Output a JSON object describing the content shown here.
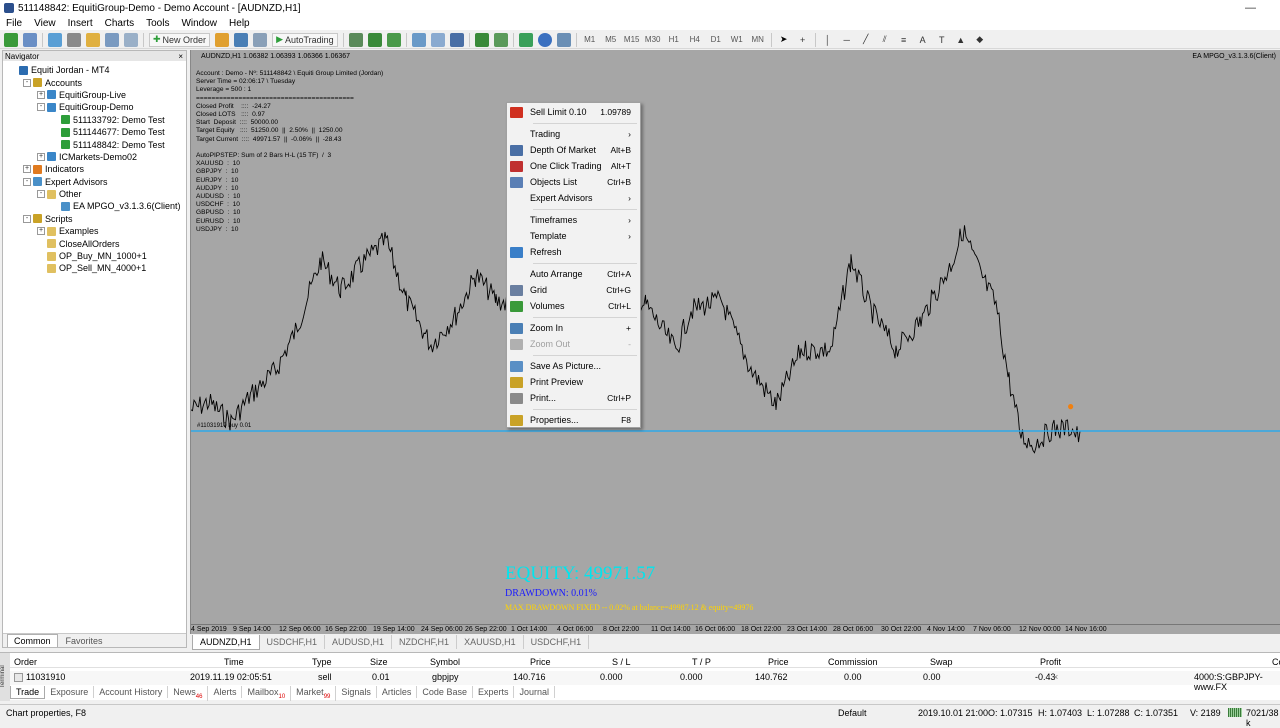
{
  "window": {
    "title": "511148842: EquitiGroup-Demo - Demo Account - [AUDNZD,H1]"
  },
  "menu": [
    "File",
    "View",
    "Insert",
    "Charts",
    "Tools",
    "Window",
    "Help"
  ],
  "toolbar": {
    "new_order": "New Order",
    "autotrading": "AutoTrading",
    "timeframes": [
      "M1",
      "M5",
      "M15",
      "M30",
      "H1",
      "H4",
      "D1",
      "W1",
      "MN"
    ]
  },
  "navigator": {
    "title": "Navigator",
    "tree": [
      {
        "label": "Equiti Jordan - MT4",
        "level": 0,
        "exp": "",
        "icon": "terminal-icon",
        "color": "#2b6cb0"
      },
      {
        "label": "Accounts",
        "level": 1,
        "exp": "-",
        "icon": "accounts-icon",
        "color": "#c9a227"
      },
      {
        "label": "EquitiGroup-Live",
        "level": 2,
        "exp": "+",
        "icon": "server-icon",
        "color": "#3a86c8"
      },
      {
        "label": "EquitiGroup-Demo",
        "level": 2,
        "exp": "-",
        "icon": "server-icon",
        "color": "#3a86c8"
      },
      {
        "label": "511133792: Demo Test",
        "level": 3,
        "exp": "",
        "icon": "user-icon",
        "color": "#2e9e3a"
      },
      {
        "label": "511144677: Demo Test",
        "level": 3,
        "exp": "",
        "icon": "user-icon",
        "color": "#2e9e3a"
      },
      {
        "label": "511148842: Demo Test",
        "level": 3,
        "exp": "",
        "icon": "user-icon",
        "color": "#2e9e3a"
      },
      {
        "label": "ICMarkets-Demo02",
        "level": 2,
        "exp": "+",
        "icon": "server-icon",
        "color": "#3a86c8"
      },
      {
        "label": "Indicators",
        "level": 1,
        "exp": "+",
        "icon": "indicators-icon",
        "color": "#e07a1f"
      },
      {
        "label": "Expert Advisors",
        "level": 1,
        "exp": "-",
        "icon": "experts-icon",
        "color": "#4a90c8"
      },
      {
        "label": "Other",
        "level": 2,
        "exp": "-",
        "icon": "folder-icon",
        "color": "#e0c060"
      },
      {
        "label": "EA MPGO_v3.1.3.6(Client)",
        "level": 3,
        "exp": "",
        "icon": "expert-icon",
        "color": "#4a90c8"
      },
      {
        "label": "Scripts",
        "level": 1,
        "exp": "-",
        "icon": "scripts-icon",
        "color": "#c9a227"
      },
      {
        "label": "Examples",
        "level": 2,
        "exp": "+",
        "icon": "folder-icon",
        "color": "#e0c060"
      },
      {
        "label": "CloseAllOrders",
        "level": 2,
        "exp": "",
        "icon": "script-icon",
        "color": "#e0c060"
      },
      {
        "label": "OP_Buy_MN_1000+1",
        "level": 2,
        "exp": "",
        "icon": "script-icon",
        "color": "#e0c060"
      },
      {
        "label": "OP_Sell_MN_4000+1",
        "level": 2,
        "exp": "",
        "icon": "script-icon",
        "color": "#e0c060"
      }
    ],
    "tabs": [
      "Common",
      "Favorites"
    ]
  },
  "chart": {
    "header": "AUDNZD,H1  1.06382 1.06393 1.06366 1.06367",
    "ea_label": "EA MPGO_v3.1.3.6(Client)",
    "info_text": "Account : Demo - Nº: 511148842 \\ Equiti Group Limited (Jordan)\nServer Time = 02:06:17 \\ Tuesday\nLeverage = 500 : 1\n=========================================\nClosed Profit    ::::  -24.27\nClosed LOTS   ::::  0.97\nStart  Deposit  ::::  50000.00\nTarget Equity   ::::  51250.00  ||  2.50%  ||  1250.00\nTarget Current  ::::  49971.57  ||  -0.06%  ||  -28.43\n\nAutoPIPSTEP: Sum of 2 Bars H-L (15 TF)  /  3\nXAUUSD  :  10\nGBPJPY  :  10\nEURJPY  :  10\nAUDJPY  :  10\nAUDUSD  :  10\nUSDCHF  :  10\nGBPUSD  :  10\nEURUSD  :  10\nUSDJPY  :  10",
    "trade_label": "#11031910 buy 0.01",
    "equity": "EQUITY:  49971.57",
    "drawdown": "DRAWDOWN: 0.01%",
    "max_drawdown": "MAX DRAWDOWN FIXED -- 0.02% at balance=49987.12 & equity=49976",
    "x_ticks": [
      "4 Sep 2019",
      "9 Sep 14:00",
      "12 Sep 06:00",
      "16 Sep 22:00",
      "19 Sep 14:00",
      "24 Sep 06:00",
      "26 Sep 22:00",
      "1 Oct 14:00",
      "4 Oct 06:00",
      "8 Oct 22:00",
      "11 Oct 14:00",
      "16 Oct 06:00",
      "18 Oct 22:00",
      "23 Oct 14:00",
      "28 Oct 06:00",
      "30 Oct 22:00",
      "4 Nov 14:00",
      "7 Nov 06:00",
      "12 Nov 00:00",
      "14 Nov 16:00"
    ],
    "symbol_tabs": [
      "AUDNZD,H1",
      "USDCHF,H1",
      "AUDUSD,H1",
      "NZDCHF,H1",
      "XAUUSD,H1",
      "USDCHF,H1"
    ]
  },
  "context_menu": {
    "items": [
      {
        "label": "Sell Limit 0.10",
        "shortcut": "1.09789",
        "icon": "sell-limit-icon",
        "color": "#d03020",
        "disabled": false,
        "arrow": false
      },
      {
        "sep": true
      },
      {
        "label": "Trading",
        "shortcut": "",
        "icon": "",
        "color": "",
        "disabled": false,
        "arrow": true
      },
      {
        "label": "Depth Of Market",
        "shortcut": "Alt+B",
        "icon": "depth-of-market-icon",
        "color": "#4a6fa5",
        "disabled": false,
        "arrow": false
      },
      {
        "label": "One Click Trading",
        "shortcut": "Alt+T",
        "icon": "one-click-trading-icon",
        "color": "#c03030",
        "disabled": false,
        "arrow": false
      },
      {
        "label": "Objects List",
        "shortcut": "Ctrl+B",
        "icon": "objects-list-icon",
        "color": "#5a7fb5",
        "disabled": false,
        "arrow": false
      },
      {
        "label": "Expert Advisors",
        "shortcut": "",
        "icon": "",
        "color": "",
        "disabled": false,
        "arrow": true
      },
      {
        "sep": true
      },
      {
        "label": "Timeframes",
        "shortcut": "",
        "icon": "",
        "color": "",
        "disabled": false,
        "arrow": true
      },
      {
        "label": "Template",
        "shortcut": "",
        "icon": "",
        "color": "",
        "disabled": false,
        "arrow": true
      },
      {
        "label": "Refresh",
        "shortcut": "",
        "icon": "refresh-icon",
        "color": "#3a7fc8",
        "disabled": false,
        "arrow": false
      },
      {
        "sep": true
      },
      {
        "label": "Auto Arrange",
        "shortcut": "Ctrl+A",
        "icon": "",
        "color": "",
        "disabled": false,
        "arrow": false
      },
      {
        "label": "Grid",
        "shortcut": "Ctrl+G",
        "icon": "grid-icon",
        "color": "#6a7fa0",
        "disabled": false,
        "arrow": false
      },
      {
        "label": "Volumes",
        "shortcut": "Ctrl+L",
        "icon": "volumes-icon",
        "color": "#3a9a3a",
        "disabled": false,
        "arrow": false
      },
      {
        "sep": true
      },
      {
        "label": "Zoom In",
        "shortcut": "+",
        "icon": "zoom-in-icon",
        "color": "#4a7fb5",
        "disabled": false,
        "arrow": false
      },
      {
        "label": "Zoom Out",
        "shortcut": "-",
        "icon": "zoom-out-icon",
        "color": "#b0b0b0",
        "disabled": true,
        "arrow": false
      },
      {
        "sep": true
      },
      {
        "label": "Save As Picture...",
        "shortcut": "",
        "icon": "save-picture-icon",
        "color": "#5a8fc5",
        "disabled": false,
        "arrow": false
      },
      {
        "label": "Print Preview",
        "shortcut": "",
        "icon": "print-preview-icon",
        "color": "#c9a227",
        "disabled": false,
        "arrow": false
      },
      {
        "label": "Print...",
        "shortcut": "Ctrl+P",
        "icon": "print-icon",
        "color": "#8a8a8a",
        "disabled": false,
        "arrow": false
      },
      {
        "sep": true
      },
      {
        "label": "Properties...",
        "shortcut": "F8",
        "icon": "properties-icon",
        "color": "#c9a227",
        "disabled": false,
        "arrow": false
      }
    ]
  },
  "terminal": {
    "strip_label": "Terminal",
    "columns": [
      "Order",
      "Time",
      "Type",
      "Size",
      "Symbol",
      "Price",
      "S / L",
      "T / P",
      "Price",
      "Commission",
      "Swap",
      "Profit",
      "Co"
    ],
    "row": {
      "order": "11031910",
      "time": "2019.11.19 02:05:51",
      "type": "sell",
      "size": "0.01",
      "symbol": "gbpjpy",
      "price": "140.716",
      "sl": "0.000",
      "tp": "0.000",
      "price2": "140.762",
      "commission": "0.00",
      "swap": "0.00",
      "profit": "-0.43",
      "close": "×",
      "comment": "4000:S:GBPJPY-www.FX"
    },
    "tabs": [
      {
        "label": "Trade",
        "badge": ""
      },
      {
        "label": "Exposure",
        "badge": ""
      },
      {
        "label": "Account History",
        "badge": ""
      },
      {
        "label": "News",
        "badge": "46"
      },
      {
        "label": "Alerts",
        "badge": ""
      },
      {
        "label": "Mailbox",
        "badge": "10"
      },
      {
        "label": "Market",
        "badge": "99"
      },
      {
        "label": "Signals",
        "badge": ""
      },
      {
        "label": "Articles",
        "badge": ""
      },
      {
        "label": "Code Base",
        "badge": ""
      },
      {
        "label": "Experts",
        "badge": ""
      },
      {
        "label": "Journal",
        "badge": ""
      }
    ]
  },
  "status": {
    "help": "Chart properties, F8",
    "profile": "Default",
    "time": "2019.10.01 21:00",
    "open": "O: 1.07315",
    "high": "H: 1.07403",
    "low": "L: 1.07288",
    "close": "C: 1.07351",
    "volume": "V: 2189",
    "traffic": "7021/38 k"
  }
}
